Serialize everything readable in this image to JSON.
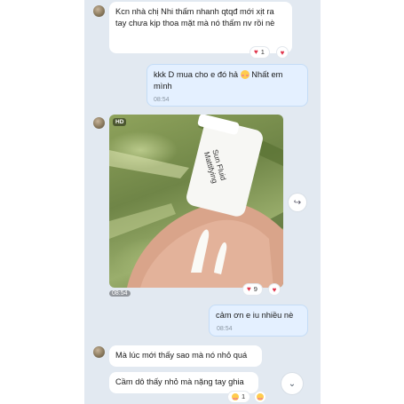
{
  "messages": {
    "m1": {
      "text": "Kcn nhà chị Nhi thấm nhanh qtqđ mới xịt ra tay chưa kịp thoa mặt mà nó thấm nv rồi nè",
      "react_count": "1"
    },
    "m2": {
      "text": "kkk D mua cho e đó hả",
      "text_after": "Nhất em mình",
      "time": "08:54"
    },
    "m3": {
      "badge": "HD",
      "bottle_text": "Sun Fluid Mattifying",
      "time": "08:54",
      "react_count": "9"
    },
    "m4": {
      "text": "cảm ơn e iu nhiều nè",
      "time": "08:54"
    },
    "m5": {
      "text": "Mà lúc mới thấy sao mà nó nhỏ quá"
    },
    "m6": {
      "text": "Cầm dô thấy nhỏ mà nặng tay ghia",
      "react_count": "1"
    }
  },
  "icons": {
    "heart": "♥",
    "share": "↪",
    "scroll_down": "⌄"
  },
  "colors": {
    "chat_bg": "#e2e9f1",
    "outgoing_bubble": "#e4f0ff",
    "incoming_bubble": "#ffffff",
    "heart": "#e0344b"
  }
}
